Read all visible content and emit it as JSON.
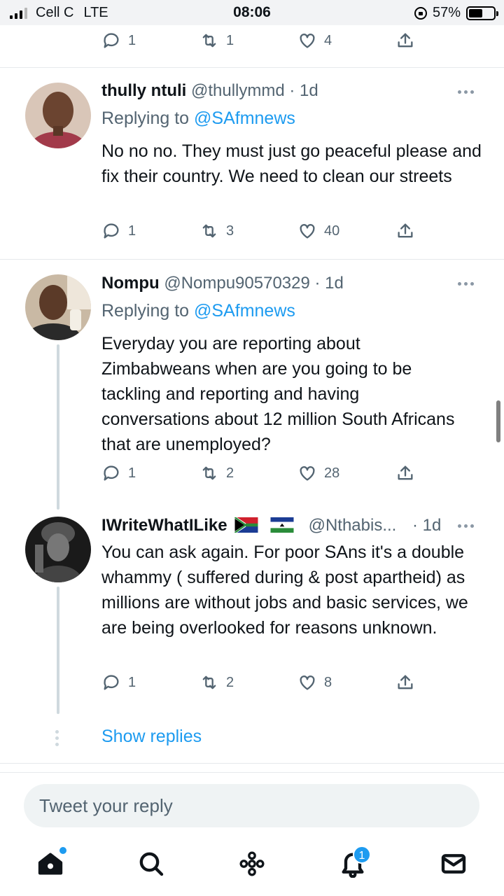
{
  "status_bar": {
    "carrier": "Cell C",
    "network": "LTE",
    "time": "08:06",
    "battery_percent": "57%",
    "battery_level": 0.57
  },
  "top_actions": {
    "replies": "1",
    "retweets": "1",
    "likes": "4"
  },
  "tweets": [
    {
      "name": "thully ntuli",
      "handle": "@thullymmd",
      "time": "· 1d",
      "replying_prefix": "Replying to ",
      "replying_to": "@SAfmnews",
      "text": "No no no. They must just go peaceful please and fix their country. We need to clean our streets",
      "replies": "1",
      "retweets": "3",
      "likes": "40"
    },
    {
      "name": "Nompu",
      "handle": "@Nompu90570329",
      "time": "· 1d",
      "replying_prefix": "Replying to ",
      "replying_to": "@SAfmnews",
      "text": "Everyday you are reporting about Zimbabweans when are you going to be tackling and reporting and having conversations about 12 million South Africans that are unemployed?",
      "replies": "1",
      "retweets": "2",
      "likes": "28"
    },
    {
      "name": "IWriteWhatILike",
      "handle": "@Nthabis...",
      "time": "· 1d",
      "text": "You can ask again. For poor SAns it's a double whammy ( suffered during & post apartheid) as millions are without jobs and basic services, we are being overlooked for reasons unknown.",
      "replies": "1",
      "retweets": "2",
      "likes": "8"
    }
  ],
  "show_replies": "Show replies",
  "composer": {
    "placeholder": "Tweet your reply"
  },
  "tabbar": {
    "notifications_badge": "1"
  },
  "colors": {
    "accent": "#1d9bf0",
    "muted": "#536471"
  }
}
